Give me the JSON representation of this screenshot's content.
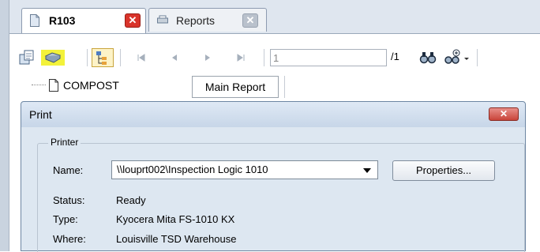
{
  "tabs": [
    {
      "label": "R103",
      "active": true
    },
    {
      "label": "Reports",
      "active": false
    }
  ],
  "toolbar": {
    "page_value": "1",
    "page_total": "/1",
    "icons": [
      "export-icon",
      "print-icon",
      "group-tree-icon",
      "first-page-icon",
      "prev-page-icon",
      "next-page-icon",
      "last-page-icon",
      "find-icon",
      "zoom-icon"
    ]
  },
  "tree": {
    "item_label": "COMPOST"
  },
  "report_tab": {
    "label": "Main Report"
  },
  "dialog": {
    "title": "Print",
    "group_label": "Printer",
    "name_label": "Name:",
    "name_value": "\\\\louprt002\\Inspection Logic 1010",
    "properties_label": "Properties...",
    "status_label": "Status:",
    "status_value": "Ready",
    "type_label": "Type:",
    "type_value": "Kyocera Mita FS-1010 KX",
    "where_label": "Where:",
    "where_value": "Louisville TSD Warehouse"
  },
  "colors": {
    "close_red": "#d9342b",
    "print_highlight": "#f3f23a"
  }
}
